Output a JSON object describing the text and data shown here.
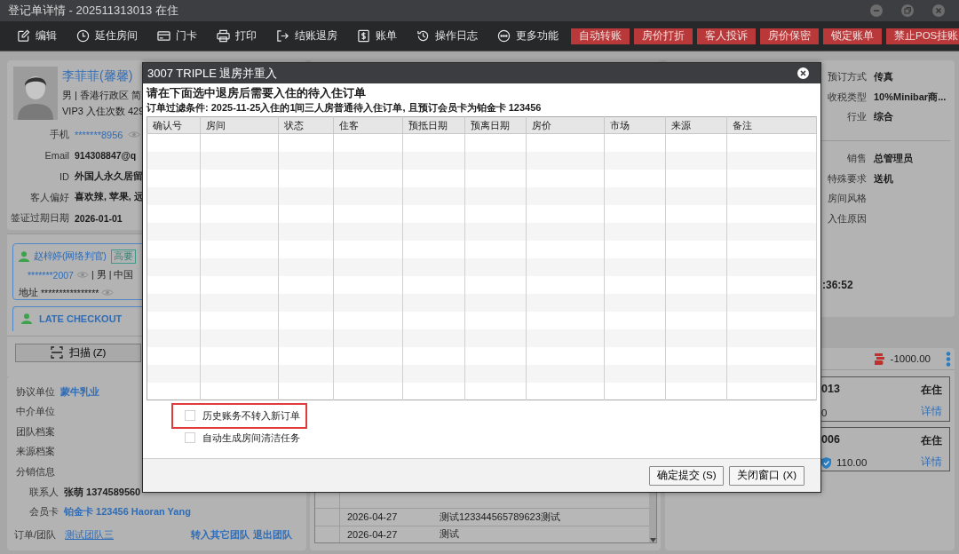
{
  "window": {
    "title": "登记单详情 - 202511313013 在住"
  },
  "toolbar": {
    "tools": [
      {
        "label": "编辑"
      },
      {
        "label": "延住房间"
      },
      {
        "label": "门卡"
      },
      {
        "label": "打印"
      },
      {
        "label": "结账退房"
      },
      {
        "label": "账单"
      },
      {
        "label": "操作日志"
      },
      {
        "label": "更多功能"
      }
    ],
    "actions": [
      {
        "label": "自动转账"
      },
      {
        "label": "房价打折"
      },
      {
        "label": "客人投诉"
      },
      {
        "label": "房价保密"
      },
      {
        "label": "锁定账单"
      },
      {
        "label": "禁止POS挂账"
      }
    ]
  },
  "guest": {
    "name": "李菲菲(馨馨)",
    "details": "男 | 香港行政区 简",
    "stats": "VIP3  入住次数 429",
    "fields": [
      {
        "label": "手机",
        "value": "*******8956",
        "kind": "masked"
      },
      {
        "label": "Email",
        "value": "914308847@q",
        "kind": "plain"
      },
      {
        "label": "ID",
        "value": "外国人永久居留",
        "kind": "plain"
      },
      {
        "label": "客人偏好",
        "value": "喜欢辣, 苹果, 远",
        "kind": "plain"
      },
      {
        "label": "签证过期日期",
        "value": "2026-01-01",
        "kind": "plain"
      }
    ]
  },
  "companions": [
    {
      "name": "赵梓婷(网络判官)",
      "tag": "高要",
      "phone": "*******2007",
      "gender": "| 男",
      "country": "| 中国",
      "address_label": "地址",
      "address": "****************"
    }
  ],
  "late_checkout": {
    "label": "LATE CHECKOUT"
  },
  "scan_button": {
    "label": "扫描 (Z)"
  },
  "profile": {
    "rows": [
      {
        "label": "协议单位",
        "value": "蒙牛乳业",
        "kind": "link"
      },
      {
        "label": "中介单位",
        "kind": "empty"
      },
      {
        "label": "团队档案",
        "kind": "empty"
      },
      {
        "label": "来源档案",
        "kind": "empty"
      },
      {
        "label": "分销信息",
        "kind": "empty",
        "children": [
          {
            "label": "联系人",
            "value": "张萌 1374589560",
            "kind": "text"
          },
          {
            "label": "会员卡",
            "value": "铂金卡 123456 Haoran Yang",
            "kind": "link"
          }
        ]
      }
    ],
    "team": {
      "label": "订单/团队",
      "link": "测试团队三",
      "actions": [
        "转入其它团队",
        "退出团队"
      ]
    }
  },
  "center_log": {
    "rows": [
      {
        "date": "2026-04-27",
        "text": "测试123344565789623测试"
      },
      {
        "date": "2026-04-27",
        "text": "测试"
      }
    ]
  },
  "right_info": {
    "rows": [
      {
        "label": "预订方式",
        "value": "传真"
      },
      {
        "label": "收税类型",
        "value": "10%Minibar商..."
      },
      {
        "label": "行业",
        "value": "综合"
      }
    ],
    "rows_2": [
      {
        "label": "销售",
        "value": "总管理员"
      },
      {
        "label": "特殊要求",
        "value": "送机"
      },
      {
        "label": "房间风格"
      },
      {
        "label": "入住原因"
      }
    ],
    "time": ":36:52"
  },
  "balance": {
    "amount": "-1000.00"
  },
  "rooms": [
    {
      "number": "013",
      "status": "在住",
      "amount": "0",
      "link": "详情",
      "kind": "plain"
    },
    {
      "number": "006",
      "status": "在住",
      "amount": "110.00",
      "link": "详情",
      "kind": "insured"
    }
  ],
  "dialog": {
    "title": "3007 TRIPLE 退房并重入",
    "heading": "请在下面选中退房后需要入住的待入住订单",
    "filter": "订单过滤条件: 2025-11-25入住的1间三人房普通待入住订单, 且预订会员卡为铂金卡 123456",
    "columns": [
      "确认号",
      "房间",
      "状态",
      "住客",
      "预抵日期",
      "预离日期",
      "房价",
      "市场",
      "来源",
      "备注"
    ],
    "options": [
      {
        "label": "历史账务不转入新订单",
        "checked": false,
        "highlighted": true
      },
      {
        "label": "自动生成房间清洁任务",
        "checked": false,
        "highlighted": false
      }
    ],
    "buttons": [
      "确定提交 (S)",
      "关闭窗口 (X)"
    ]
  }
}
